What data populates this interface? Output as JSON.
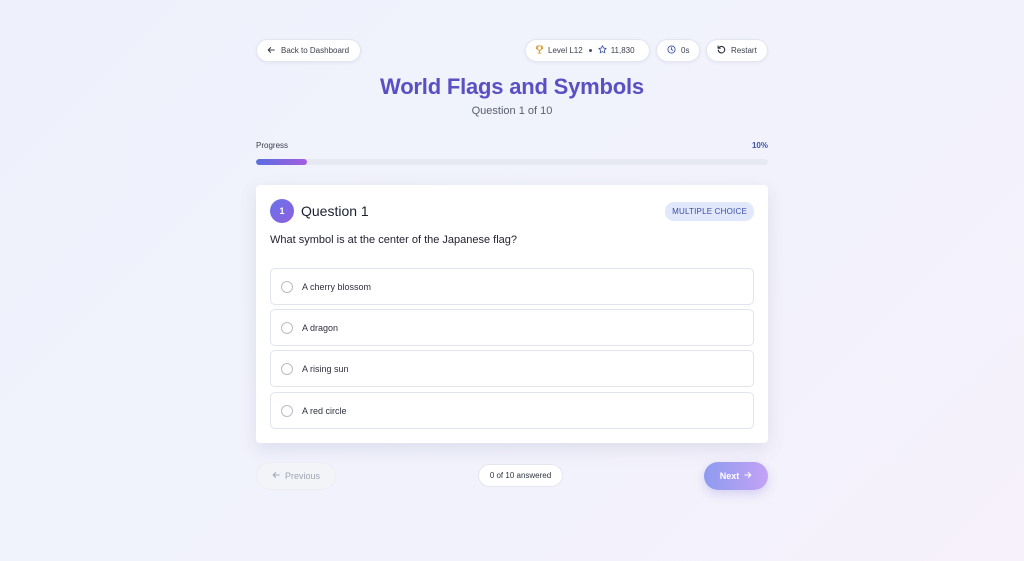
{
  "nav": {
    "back_label": "Back to Dashboard",
    "restart_label": "Restart"
  },
  "stats": {
    "level": "Level L12",
    "points": "11,830",
    "timer": "0s"
  },
  "quiz": {
    "title": "World Flags and Symbols",
    "question_counter": "Question 1 of 10"
  },
  "progress": {
    "label": "Progress",
    "percent_text": "10%",
    "value": 10
  },
  "question": {
    "number": "1",
    "title": "Question 1",
    "type_badge": "MULTIPLE CHOICE",
    "text": "What symbol is at the center of the Japanese flag?",
    "options": [
      "A cherry blossom",
      "A dragon",
      "A rising sun",
      "A red circle"
    ]
  },
  "footer": {
    "previous_label": "Previous",
    "answered_text": "0 of 10 answered",
    "next_label": "Next"
  },
  "colors": {
    "accent": "#5b4fc4",
    "progress_start": "#5b6ee0",
    "progress_end": "#a35fe0",
    "badge_bg": "#e2e8fb"
  }
}
